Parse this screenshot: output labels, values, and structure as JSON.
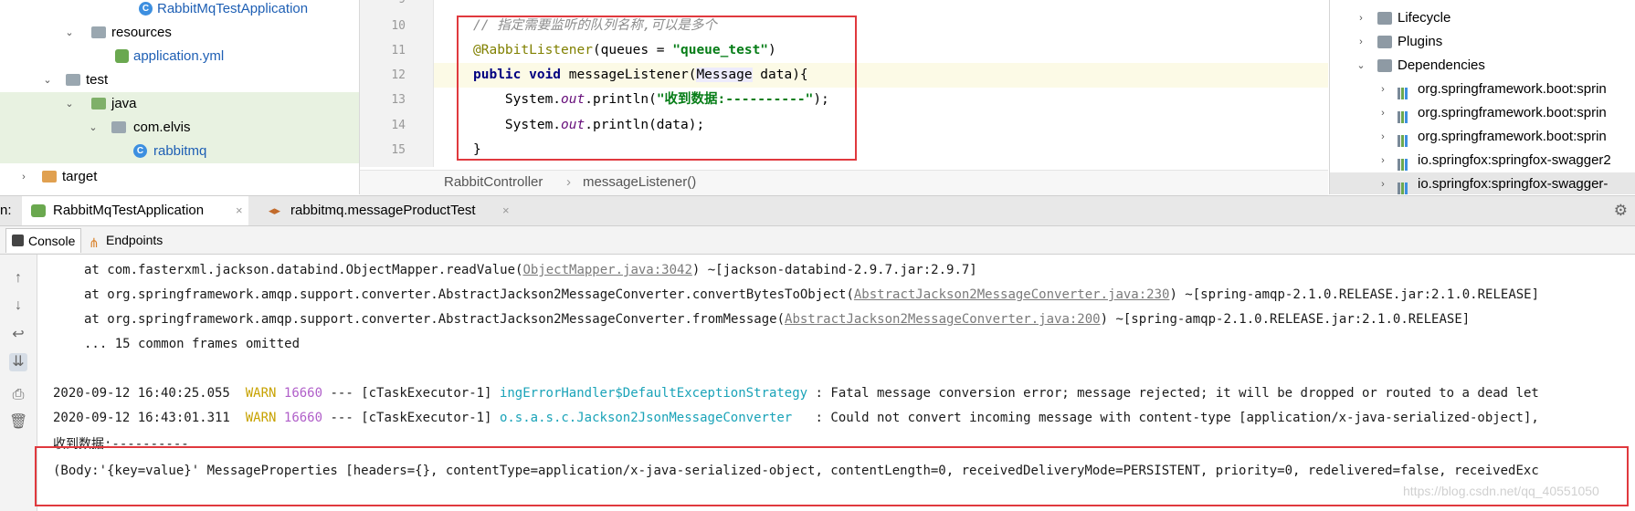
{
  "project_tree": {
    "items": [
      {
        "label": "RabbitMqTestApplication",
        "icon": "java-class-icon"
      },
      {
        "label": "resources",
        "icon": "folder-icon"
      },
      {
        "label": "application.yml",
        "icon": "yaml-file-icon"
      },
      {
        "label": "test",
        "icon": "folder-icon"
      },
      {
        "label": "java",
        "icon": "folder-icon"
      },
      {
        "label": "com.elvis",
        "icon": "package-icon"
      },
      {
        "label": "rabbitmq",
        "icon": "java-class-icon"
      },
      {
        "label": "target",
        "icon": "folder-icon"
      }
    ]
  },
  "editor": {
    "line_numbers": [
      "10",
      "11",
      "12",
      "13",
      "14",
      "15"
    ],
    "line10_comment": "// 指定需要监听的队列名称,可以是多个",
    "line11_annotation": "@RabbitListener",
    "line11_rest": "(queues = ",
    "line11_string": "\"queue_test\"",
    "line11_end": ")",
    "line12_kw": "public void",
    "line12_name": " messageListener(",
    "line12_type": "Message",
    "line12_rest": " data){",
    "line13_prefix": "    System.",
    "line13_field": "out",
    "line13_mid": ".println(",
    "line13_string": "\"收到数据:----------\"",
    "line13_end": ");",
    "line14_prefix": "    System.",
    "line14_field": "out",
    "line14_rest": ".println(data);",
    "line15": "}",
    "partial_line": "9"
  },
  "breadcrumb": {
    "items": [
      "RabbitController",
      "messageListener()"
    ],
    "separator": "›"
  },
  "maven": {
    "items": [
      {
        "label": "Lifecycle"
      },
      {
        "label": "Plugins"
      },
      {
        "label": "Dependencies"
      },
      {
        "label": "org.springframework.boot:sprin"
      },
      {
        "label": "org.springframework.boot:sprin"
      },
      {
        "label": "org.springframework.boot:sprin"
      },
      {
        "label": "io.springfox:springfox-swagger2"
      },
      {
        "label": "io.springfox:springfox-swagger-"
      }
    ]
  },
  "run_panel": {
    "prefix": "n:",
    "tabs": [
      {
        "label": "RabbitMqTestApplication"
      },
      {
        "label": "rabbitmq.messageProductTest"
      }
    ],
    "close": "×",
    "subtabs": [
      {
        "label": "Console"
      },
      {
        "label": "Endpoints"
      }
    ]
  },
  "console": {
    "line1_prefix": "at com.fasterxml.jackson.databind.ObjectMapper.readValue(",
    "line1_link": "ObjectMapper.java:3042",
    "line1_suffix": ") ~[jackson-databind-2.9.7.jar:2.9.7]",
    "line2_prefix": "at org.springframework.amqp.support.converter.AbstractJackson2MessageConverter.convertBytesToObject(",
    "line2_link": "AbstractJackson2MessageConverter.java:230",
    "line2_suffix": ") ~[spring-amqp-2.1.0.RELEASE.jar:2.1.0.RELEASE]",
    "line3_prefix": "at org.springframework.amqp.support.converter.AbstractJackson2MessageConverter.fromMessage(",
    "line3_link": "AbstractJackson2MessageConverter.java:200",
    "line3_suffix": ") ~[spring-amqp-2.1.0.RELEASE.jar:2.1.0.RELEASE]",
    "line4": "... 15 common frames omitted",
    "log1_time": "2020-09-12 16:40:25.055",
    "log1_level": "WARN",
    "log1_pid": "16660",
    "log1_thread": "--- [cTaskExecutor-1]",
    "log1_logger": "ingErrorHandler$DefaultExceptionStrategy",
    "log1_msg": ": Fatal message conversion error; message rejected; it will be dropped or routed to a dead let",
    "log2_time": "2020-09-12 16:43:01.311",
    "log2_level": "WARN",
    "log2_pid": "16660",
    "log2_thread": "--- [cTaskExecutor-1]",
    "log2_logger": "o.s.a.s.c.Jackson2JsonMessageConverter",
    "log2_msg": ": Could not convert incoming message with content-type [application/x-java-serialized-object],",
    "recv_line": "收到数据:----------",
    "body_line": "(Body:'{key=value}' MessageProperties [headers={}, contentType=application/x-java-serialized-object, contentLength=0, receivedDeliveryMode=PERSISTENT, priority=0, redelivered=false, receivedExc"
  },
  "watermark": "https://blog.csdn.net/qq_40551050",
  "colors": {
    "highlight_box": "#e0393e",
    "string": "#067d17",
    "keyword": "#000080",
    "annotation": "#808000",
    "warn": "#c7a200",
    "logger": "#1aa3b8"
  }
}
